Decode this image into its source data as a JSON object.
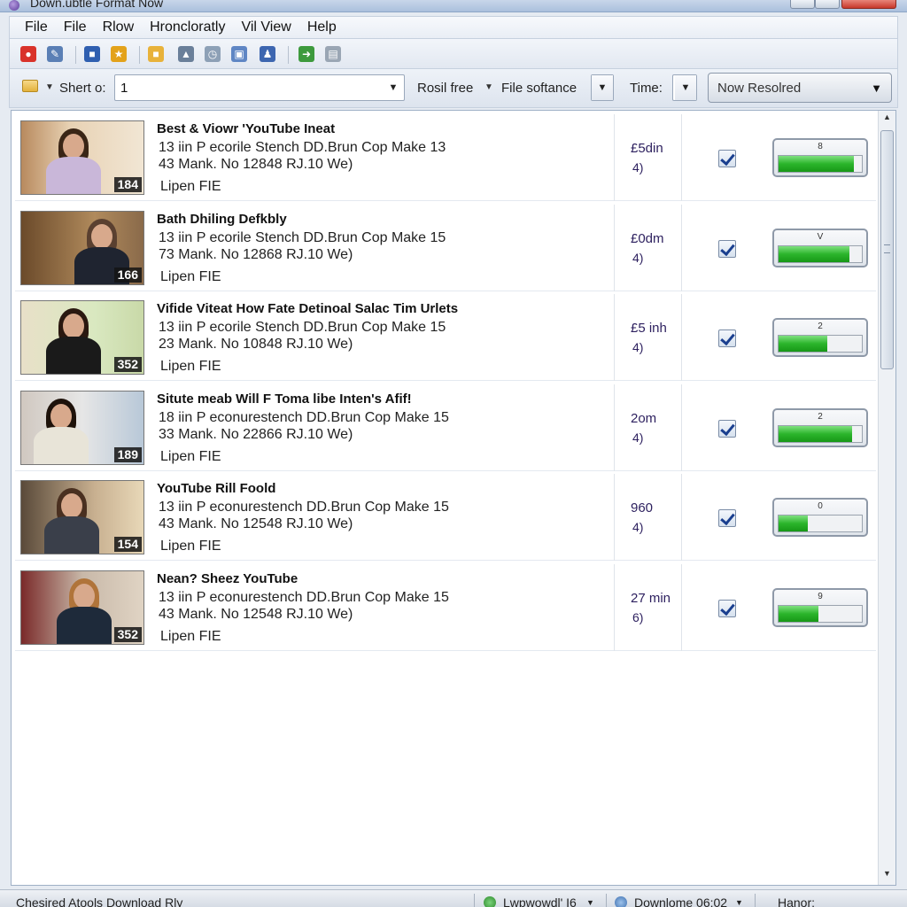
{
  "window": {
    "title": "Down.ubtle Format Now"
  },
  "menu": [
    "File",
    "File",
    "Rlow",
    "Hroncloratly",
    "Vil View",
    "Help"
  ],
  "toolbar_icons": [
    {
      "name": "stop-icon",
      "color": "#d9322a",
      "glyph": "●"
    },
    {
      "name": "settings-icon",
      "color": "#5a7fb5",
      "glyph": "✎"
    },
    {
      "name": "monitor-icon",
      "color": "#2f5fb0",
      "glyph": "■"
    },
    {
      "name": "folder-star-icon",
      "color": "#e3a21a",
      "glyph": "★"
    },
    {
      "name": "folder-icon",
      "color": "#e8b23a",
      "glyph": "■"
    },
    {
      "name": "upload-arrow-icon",
      "color": "#6a7f99",
      "glyph": "▲"
    },
    {
      "name": "clock-icon",
      "color": "#8da0b6",
      "glyph": "◷"
    },
    {
      "name": "window-icon",
      "color": "#5f86c4",
      "glyph": "▣"
    },
    {
      "name": "users-icon",
      "color": "#3d66b0",
      "glyph": "♟"
    },
    {
      "name": "go-icon",
      "color": "#3d9a3d",
      "glyph": "➜"
    },
    {
      "name": "document-icon",
      "color": "#9aa6b4",
      "glyph": "▤"
    }
  ],
  "search": {
    "short_label": "Shert o:",
    "query_value": "1",
    "filter_label": "Rosil free",
    "software_label": "File softance",
    "time_label": "Time:",
    "resolved_button": "Now Resolred"
  },
  "items": [
    {
      "title": "Best & Viowr 'YouTube Ineat",
      "line1": "13 iin P ecorile Stench DD.Brun Cop Make 13",
      "line2": "43 Mank. No 12848 RJ.10 We)",
      "file": "Lipen FIE",
      "duration": "184",
      "size": "£5din",
      "size_sub": "4)",
      "progress_label": "8",
      "progress": 0.9
    },
    {
      "title": "Bath Dhiling Defkbly",
      "line1": "13 iin P ecorile Stench DD.Brun Cop Make 15",
      "line2": "73 Mank. No 12868 RJ.10 We)",
      "file": "Lipen FIE",
      "duration": "166",
      "size": "£0dm",
      "size_sub": "4)",
      "progress_label": "V",
      "progress": 0.85
    },
    {
      "title": "Vifide Viteat How Fate Detinoal Salac Tim Urlets",
      "line1": "13 iin P ecorile Stench DD.Brun Cop Make 15",
      "line2": "23 Mank. No 10848 RJ.10 We)",
      "file": "Lipen FIE",
      "duration": "352",
      "size": "£5 inh",
      "size_sub": "4)",
      "progress_label": "2",
      "progress": 0.58
    },
    {
      "title": "Situte meab Will F Toma libe Inten's Afif!",
      "line1": "18 iin P econurestench DD.Brun Cop Make 15",
      "line2": "33 Mank. No 22866 RJ.10 We)",
      "file": "Lipen FIE",
      "duration": "189",
      "size": "2om",
      "size_sub": "4)",
      "progress_label": "2",
      "progress": 0.88
    },
    {
      "title": "YouTube Rill Foold",
      "line1": "13 iin P econurestench DD.Brun Cop Make 15",
      "line2": "43 Mank. No 12548 RJ.10 We)",
      "file": "Lipen FIE",
      "duration": "154",
      "size": "960",
      "size_sub": "4)",
      "progress_label": "0",
      "progress": 0.35
    },
    {
      "title": "Nean? Sheez YouTube",
      "line1": "13 iin P econurestench DD.Brun Cop Make 15",
      "line2": "43 Mank. No 12548 RJ.10 We)",
      "file": "Lipen FIE",
      "duration": "352",
      "size": "27 min",
      "size_sub": "6)",
      "progress_label": "9",
      "progress": 0.48
    }
  ],
  "status": {
    "left": "Chesired Atools Download Rly",
    "mid": "Lwpwowdl' I6",
    "download": "Downlome 06:02",
    "right": "Hanor:"
  },
  "colors": {
    "accent_green": "#2bb52b",
    "size_text": "#2c1f5e",
    "title_bar": "#aac0dd"
  }
}
